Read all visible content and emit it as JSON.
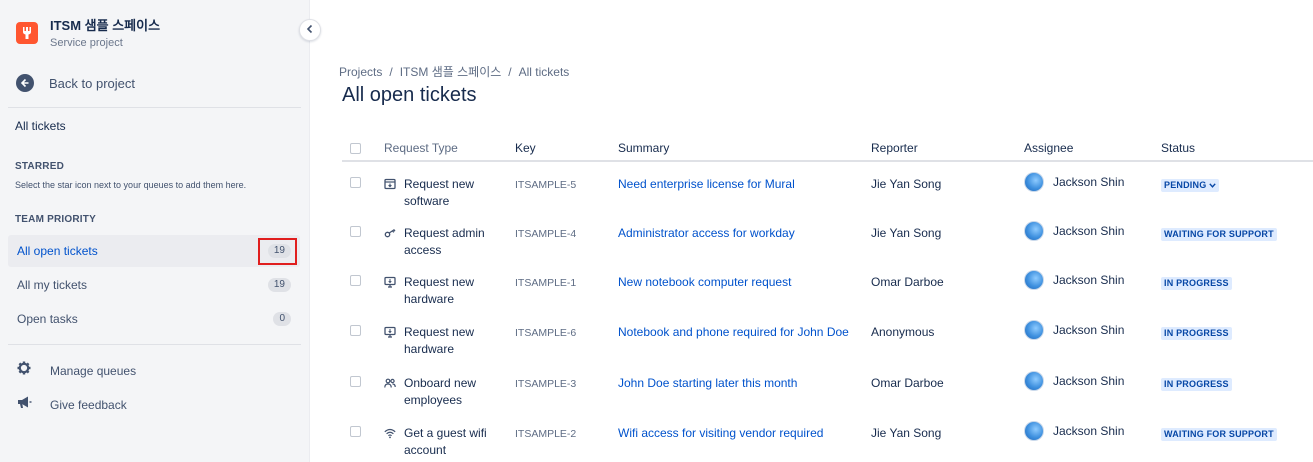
{
  "project": {
    "name": "ITSM 샘플 스페이스",
    "type": "Service project",
    "logo_color": "#ff5630"
  },
  "sidebar": {
    "back_label": "Back to project",
    "all_tickets": "All tickets",
    "starred_heading": "STARRED",
    "starred_desc": "Select the star icon next to your queues to add them here.",
    "team_priority_heading": "TEAM PRIORITY",
    "queues": [
      {
        "label": "All open tickets",
        "count": "19",
        "active": true
      },
      {
        "label": "All my tickets",
        "count": "19"
      },
      {
        "label": "Open tasks",
        "count": "0"
      }
    ],
    "manage_queues": "Manage queues",
    "give_feedback": "Give feedback"
  },
  "breadcrumb": [
    "Projects",
    "ITSM 샘플 스페이스",
    "All tickets"
  ],
  "page_title": "All open tickets",
  "table": {
    "columns": [
      "Request Type",
      "Key",
      "Summary",
      "Reporter",
      "Assignee",
      "Status"
    ],
    "rows": [
      {
        "icon": "software-icon",
        "request_type": "Request new software",
        "key": "ITSAMPLE-5",
        "summary": "Need enterprise license for Mural",
        "reporter": "Jie Yan Song",
        "assignee": "Jackson Shin",
        "status": "PENDING"
      },
      {
        "icon": "key-icon",
        "request_type": "Request admin access",
        "key": "ITSAMPLE-4",
        "summary": "Administrator access for workday",
        "reporter": "Jie Yan Song",
        "assignee": "Jackson Shin",
        "status": "WAITING FOR SUPPORT"
      },
      {
        "icon": "hardware-icon",
        "request_type": "Request new hardware",
        "key": "ITSAMPLE-1",
        "summary": "New notebook computer request",
        "reporter": "Omar Darboe",
        "assignee": "Jackson Shin",
        "status": "IN PROGRESS"
      },
      {
        "icon": "hardware-icon",
        "request_type": "Request new hardware",
        "key": "ITSAMPLE-6",
        "summary": "Notebook and phone required for John Doe",
        "reporter": "Anonymous",
        "assignee": "Jackson Shin",
        "status": "IN PROGRESS"
      },
      {
        "icon": "people-icon",
        "request_type": "Onboard new employees",
        "key": "ITSAMPLE-3",
        "summary": "John Doe starting later this month",
        "reporter": "Omar Darboe",
        "assignee": "Jackson Shin",
        "status": "IN PROGRESS"
      },
      {
        "icon": "wifi-icon",
        "request_type": "Get a guest wifi account",
        "key": "ITSAMPLE-2",
        "summary": "Wifi access for visiting vendor required",
        "reporter": "Jie Yan Song",
        "assignee": "Jackson Shin",
        "status": "WAITING FOR SUPPORT"
      }
    ]
  },
  "colors": {
    "link": "#0052cc",
    "status_bg": "#deebff",
    "status_text": "#0747a6",
    "highlight": "#e01e1e"
  }
}
